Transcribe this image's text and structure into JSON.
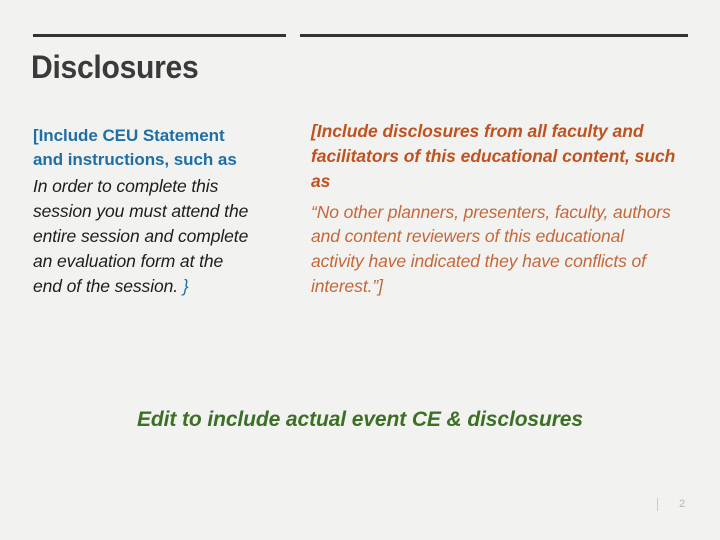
{
  "slide": {
    "title": "Disclosures",
    "background_color": "#F2F2F0",
    "title_color": "#3A3A3A",
    "rule_color": "#333333"
  },
  "left_column": {
    "lead": "[Include CEU Statement and instructions, such as",
    "lead_color": "#1F6FA5",
    "body": "In order to complete this session you must attend the entire session and complete an evaluation form at the end of the session.",
    "body_color": "#1D1D1B",
    "closing_brace": "}",
    "closing_brace_color": "#1F6FA5"
  },
  "right_column": {
    "lead": "[Include disclosures from all faculty and facilitators of this educational content, such as",
    "lead_color": "#C0521F",
    "body": "“No other planners, presenters, faculty, authors and content reviewers of this educational activity have indicated they have conflicts of interest.”]",
    "body_color": "#C4683A"
  },
  "callout": {
    "text": "Edit to include actual event CE & disclosures",
    "color": "#3C7026"
  },
  "footer": {
    "page_number": "2",
    "page_number_color": "#B6B6B4",
    "divider_color": "#C9C9C7"
  }
}
